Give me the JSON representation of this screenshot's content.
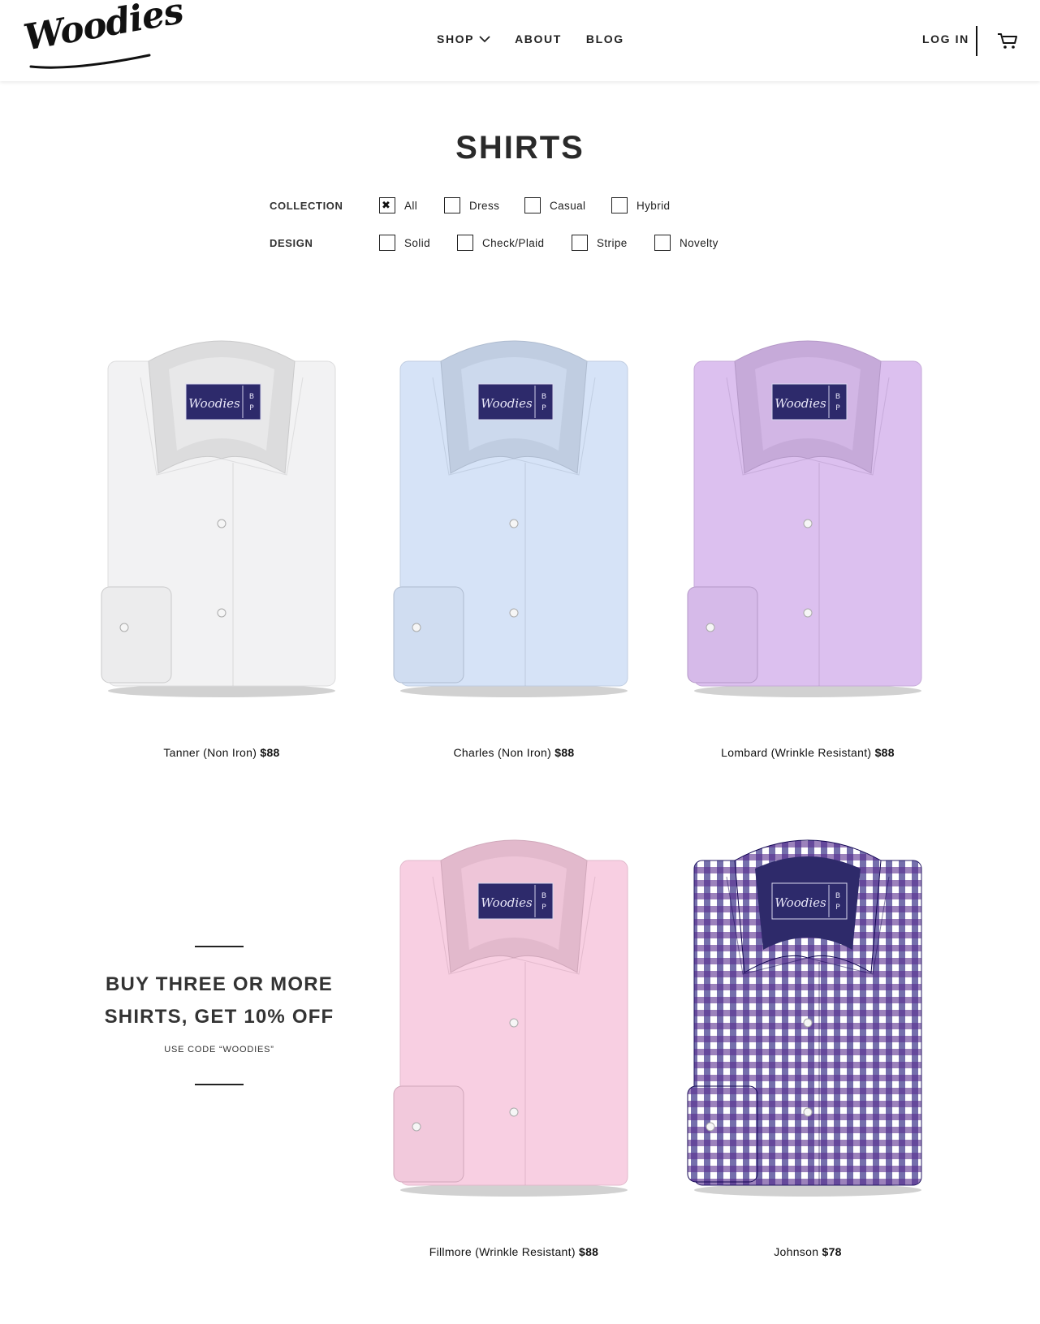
{
  "header": {
    "logo_text": "Woodies",
    "nav": [
      {
        "label": "SHOP"
      },
      {
        "label": "ABOUT"
      },
      {
        "label": "BLOG"
      }
    ],
    "login_label": "LOG IN",
    "cart_icon": "cart-icon"
  },
  "page": {
    "title": "SHIRTS"
  },
  "filters": {
    "collection": {
      "label": "COLLECTION",
      "options": [
        {
          "label": "All",
          "checked": true
        },
        {
          "label": "Dress",
          "checked": false
        },
        {
          "label": "Casual",
          "checked": false
        },
        {
          "label": "Hybrid",
          "checked": false
        }
      ]
    },
    "design": {
      "label": "DESIGN",
      "options": [
        {
          "label": "Solid",
          "checked": false
        },
        {
          "label": "Check/Plaid",
          "checked": false
        },
        {
          "label": "Stripe",
          "checked": false
        },
        {
          "label": "Novelty",
          "checked": false
        }
      ]
    }
  },
  "products": [
    {
      "name": "Tanner (Non Iron)",
      "price": "$88",
      "color": "#f2f2f3"
    },
    {
      "name": "Charles (Non Iron)",
      "price": "$88",
      "color": "#d6e3f7"
    },
    {
      "name": "Lombard (Wrinkle Resistant)",
      "price": "$88",
      "color": "#dcc0ef"
    },
    {
      "name": "Fillmore (Wrinkle Resistant)",
      "price": "$88",
      "color": "#f8cfe2"
    },
    {
      "name": "Johnson",
      "price": "$78",
      "color": "#3a2e7a"
    }
  ],
  "label_badge": {
    "brand": "Woodies",
    "initials": [
      "B",
      "P"
    ]
  },
  "promo": {
    "headline_line1": "BUY THREE OR MORE",
    "headline_line2": "SHIRTS, GET 10% OFF",
    "subtext": "USE CODE “WOODIES”"
  }
}
